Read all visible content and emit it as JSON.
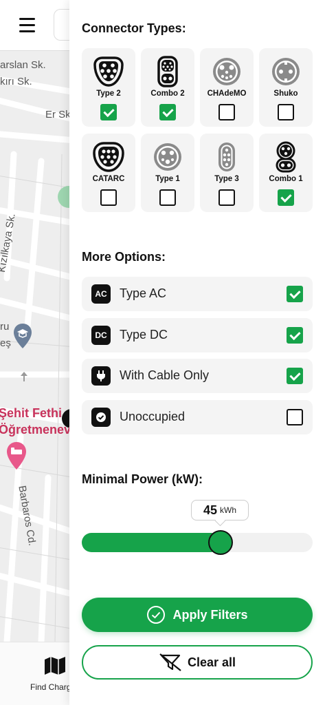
{
  "map": {
    "street_labels": [
      "arslan Sk.",
      "kırı Sk.",
      "Er Sk",
      "Kızılkaya Sk.",
      "ru",
      "eş",
      "Barbaros Cd."
    ],
    "poi_label_line1": "Şehit Fethi",
    "poi_label_line2": "Öğretmenev",
    "bottom_nav_label": "Find Charg",
    "icons": [
      "menu-icon",
      "school-pin-icon",
      "hotel-pin-icon",
      "map-icon"
    ]
  },
  "filters": {
    "connector_title": "Connector Types:",
    "connectors": [
      {
        "label": "Type 2",
        "checked": true,
        "icon": "type2-connector-icon"
      },
      {
        "label": "Combo 2",
        "checked": true,
        "icon": "combo2-connector-icon"
      },
      {
        "label": "CHAdeMO",
        "checked": false,
        "icon": "chademo-connector-icon"
      },
      {
        "label": "Shuko",
        "checked": false,
        "icon": "shuko-connector-icon"
      },
      {
        "label": "CATARC",
        "checked": false,
        "icon": "catarc-connector-icon"
      },
      {
        "label": "Type 1",
        "checked": false,
        "icon": "type1-connector-icon"
      },
      {
        "label": "Type 3",
        "checked": false,
        "icon": "type3-connector-icon"
      },
      {
        "label": "Combo 1",
        "checked": true,
        "icon": "combo1-connector-icon"
      }
    ],
    "options_title": "More Options:",
    "options": [
      {
        "badge": "AC",
        "label": "Type AC",
        "checked": true
      },
      {
        "badge": "DC",
        "label": "Type DC",
        "checked": true
      },
      {
        "badge": "",
        "label": "With Cable Only",
        "checked": true,
        "icon": "plug-icon"
      },
      {
        "badge": "",
        "label": "Unoccupied",
        "checked": false,
        "icon": "check-circle-icon"
      }
    ],
    "power_title": "Minimal Power (kW):",
    "power_value": "45",
    "power_unit": "kWh",
    "power_fraction": 0.6,
    "apply_label": "Apply Filters",
    "clear_label": "Clear all"
  },
  "colors": {
    "accent": "#16a34a",
    "dark": "#111111",
    "card_bg": "#f4f4f4"
  }
}
